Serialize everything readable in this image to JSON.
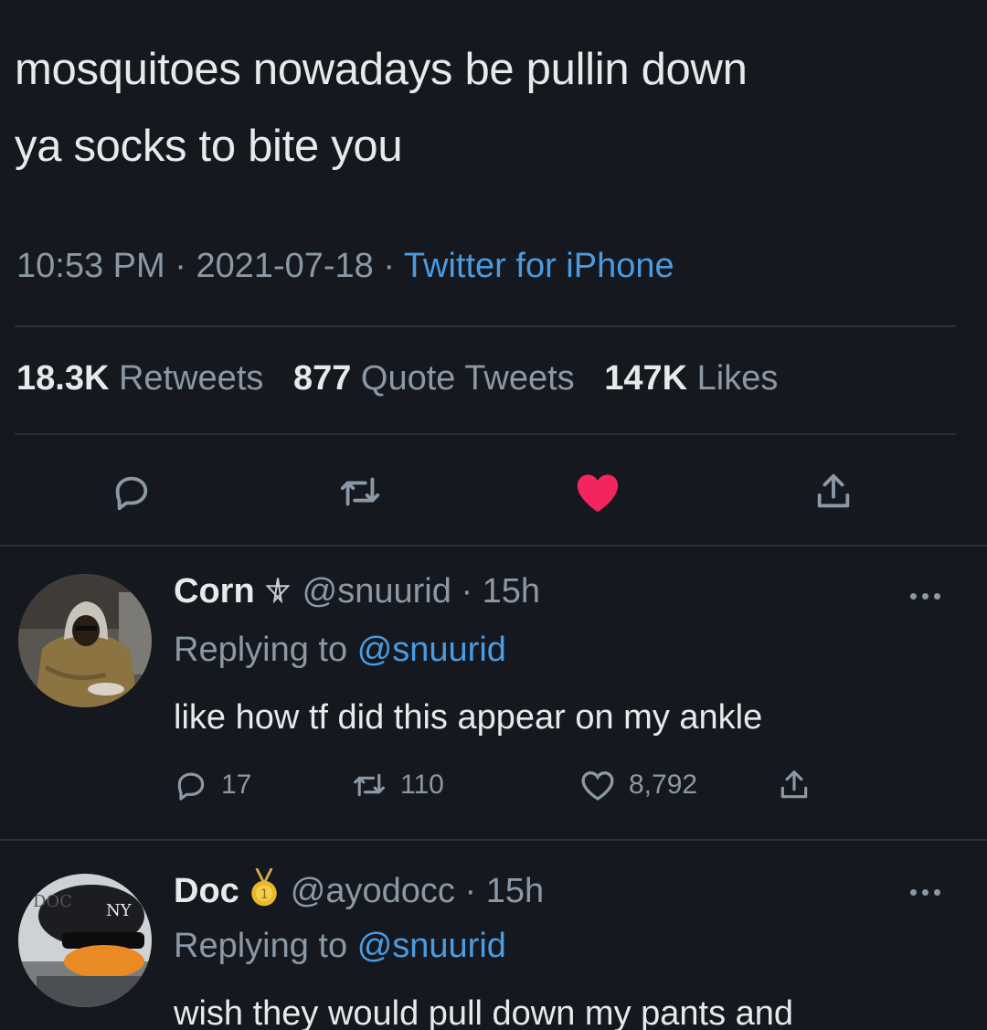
{
  "tweet": {
    "text_line1": "mosquitoes nowadays be pullin down",
    "text_line2": "ya socks to bite you",
    "time": "10:53 PM",
    "date": "2021-07-18",
    "source": "Twitter for iPhone",
    "separator": "·"
  },
  "stats": {
    "retweets_count": "18.3K",
    "retweets_label": "Retweets",
    "quotes_count": "877",
    "quotes_label": "Quote Tweets",
    "likes_count": "147K",
    "likes_label": "Likes"
  },
  "colors": {
    "background": "#15181f",
    "link": "#4a9be0",
    "like_active": "#f4245e",
    "muted": "#8b98a5"
  },
  "icons": [
    "reply-icon",
    "retweet-icon",
    "heart-filled-icon",
    "share-icon",
    "more-icon"
  ],
  "replies": [
    {
      "name": "Corn",
      "badge": "pentagram-icon",
      "handle": "@snuurid",
      "age": "· 15h",
      "replying_prefix": "Replying to",
      "replying_to": "@snuurid",
      "text": "like how tf did this appear on my ankle",
      "reply_count": "17",
      "retweet_count": "110",
      "like_count": "8,792"
    },
    {
      "name": "Doc",
      "badge": "gold-medal-icon",
      "handle": "@ayodocc",
      "age": "· 15h",
      "replying_prefix": "Replying to",
      "replying_to": "@snuurid",
      "text": "wish they would pull down my pants and"
    }
  ]
}
